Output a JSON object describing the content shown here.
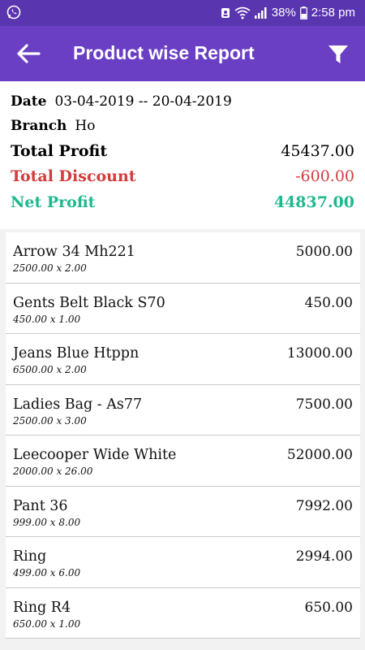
{
  "status": {
    "battery": "38%",
    "time": "2:58 pm",
    "icons": [
      "whatsapp-icon",
      "notification-icon",
      "wifi-icon",
      "signal-icon",
      "battery-icon"
    ]
  },
  "header": {
    "title": "Product wise Report",
    "back_icon": "arrow-left-icon",
    "filter_icon": "filter-icon"
  },
  "summary": {
    "date_label": "Date",
    "date_value": "03-04-2019 -- 20-04-2019",
    "branch_label": "Branch",
    "branch_value": "Ho",
    "total_profit_label": "Total Profit",
    "total_profit_value": "45437.00",
    "total_discount_label": "Total Discount",
    "total_discount_value": "-600.00",
    "net_profit_label": "Net Profit",
    "net_profit_value": "44837.00"
  },
  "colors": {
    "status_bar": "#5a35b0",
    "app_bar": "#6a3fc4",
    "discount": "#d33c3c",
    "net_profit": "#1fb88f"
  },
  "items": [
    {
      "name": "Arrow 34 Mh221",
      "detail": "2500.00 x 2.00",
      "amount": "5000.00"
    },
    {
      "name": "Gents Belt Black S70",
      "detail": "450.00 x 1.00",
      "amount": "450.00"
    },
    {
      "name": "Jeans Blue Htppn",
      "detail": "6500.00 x 2.00",
      "amount": "13000.00"
    },
    {
      "name": "Ladies Bag - As77",
      "detail": "2500.00 x 3.00",
      "amount": "7500.00"
    },
    {
      "name": "Leecooper Wide White",
      "detail": "2000.00 x 26.00",
      "amount": "52000.00"
    },
    {
      "name": "Pant 36",
      "detail": "999.00 x 8.00",
      "amount": "7992.00"
    },
    {
      "name": "Ring",
      "detail": "499.00 x 6.00",
      "amount": "2994.00"
    },
    {
      "name": "Ring R4",
      "detail": "650.00 x 1.00",
      "amount": "650.00"
    }
  ]
}
